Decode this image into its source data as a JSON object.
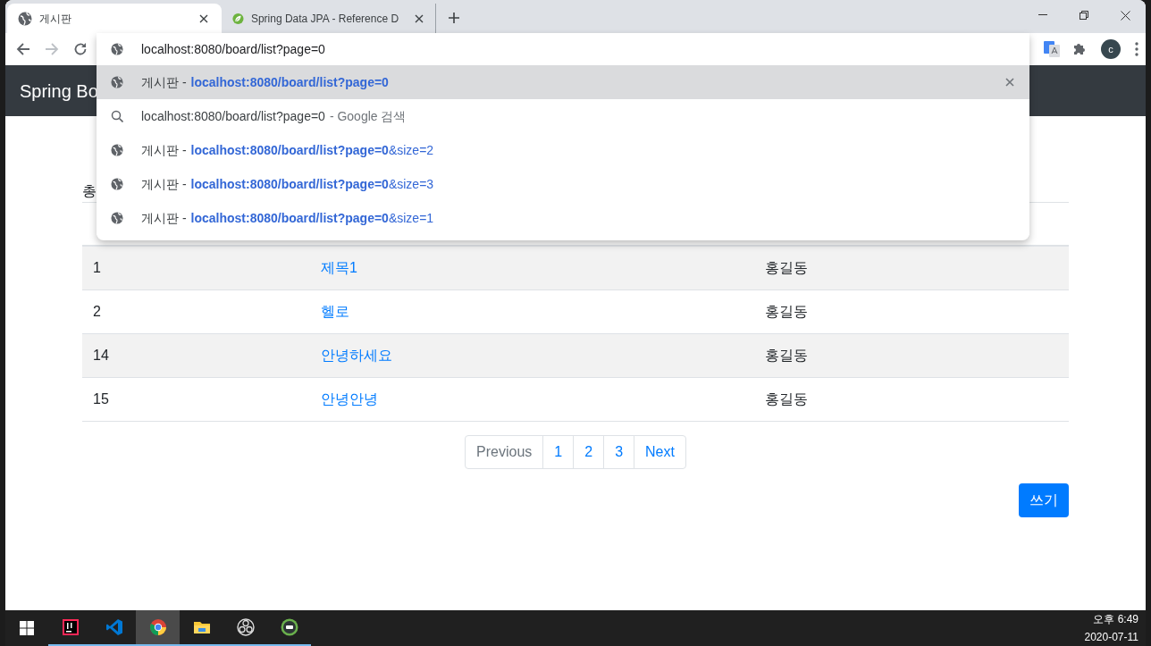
{
  "tabs": [
    {
      "kind": "globe",
      "title": "게시판",
      "selected": true
    },
    {
      "kind": "leaf",
      "title": "Spring Data JPA - Reference D",
      "selected": false
    }
  ],
  "omnibox": {
    "value": "localhost:8080/board/list?page=0"
  },
  "avatar": "c",
  "suggestions": [
    {
      "kind": "history",
      "title": "게시판 -",
      "url": "**localhost:8080/board/list?page=0**",
      "selected": true
    },
    {
      "kind": "search",
      "title": "localhost:8080/board/list?page=0",
      "url": "- Google 검색",
      "selected": false
    },
    {
      "kind": "history",
      "title": "게시판 -",
      "url": "**localhost:8080/board/list?page=0**&size=2",
      "selected": false
    },
    {
      "kind": "history",
      "title": "게시판 -",
      "url": "**localhost:8080/board/list?page=0**&size=3",
      "selected": false
    },
    {
      "kind": "history",
      "title": "게시판 -",
      "url": "**localhost:8080/board/list?page=0**&size=1",
      "selected": false
    }
  ],
  "navbar": {
    "brand": "Spring Bo"
  },
  "summary": "총",
  "table": {
    "rows": [
      {
        "no": "1",
        "title": "제목1",
        "author": "홍길동"
      },
      {
        "no": "2",
        "title": "헬로",
        "author": "홍길동"
      },
      {
        "no": "14",
        "title": "안녕하세요",
        "author": "홍길동"
      },
      {
        "no": "15",
        "title": "안녕안녕",
        "author": "홍길동"
      }
    ]
  },
  "pagination": [
    {
      "label": "Previous",
      "disabled": true
    },
    {
      "label": "1",
      "disabled": false
    },
    {
      "label": "2",
      "disabled": false
    },
    {
      "label": "3",
      "disabled": false
    },
    {
      "label": "Next",
      "disabled": false
    }
  ],
  "write_button": "쓰기",
  "taskbar": {
    "apps": [
      {
        "kind": "intellij",
        "active": false
      },
      {
        "kind": "vscode",
        "active": false
      },
      {
        "kind": "chrome",
        "active": true
      },
      {
        "kind": "folder",
        "active": false
      },
      {
        "kind": "obs",
        "active": false
      },
      {
        "kind": "hs",
        "active": false
      }
    ],
    "time": "오후 6:49",
    "date": "2020-07-11"
  }
}
